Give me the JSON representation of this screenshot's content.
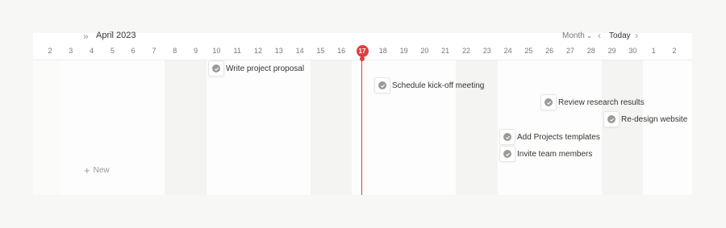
{
  "header": {
    "month_label": "April 2023",
    "view_label": "Month",
    "today_label": "Today",
    "days": [
      "2",
      "3",
      "4",
      "5",
      "6",
      "7",
      "8",
      "9",
      "10",
      "11",
      "12",
      "13",
      "14",
      "15",
      "16",
      "17",
      "18",
      "19",
      "20",
      "21",
      "22",
      "23",
      "24",
      "25",
      "26",
      "27",
      "28",
      "29",
      "30",
      "1",
      "2"
    ],
    "current_day": "17"
  },
  "tasks": [
    {
      "label": "Write project proposal"
    },
    {
      "label": "Schedule kick-off meeting"
    },
    {
      "label": "Review research results"
    },
    {
      "label": "Re-design website"
    },
    {
      "label": "Add Projects templates"
    },
    {
      "label": "Invite team members"
    }
  ],
  "new_label": "New",
  "icons": {
    "back": "chevron-double-left-icon",
    "view_caret": "chevron-down-icon",
    "prev": "chevron-left-icon",
    "next": "chevron-right-icon",
    "task_status": "check-circle-icon",
    "add": "plus-icon"
  },
  "colors": {
    "today_marker": "#e03e3e",
    "check": "#9b9a97",
    "text": "#37352f"
  }
}
